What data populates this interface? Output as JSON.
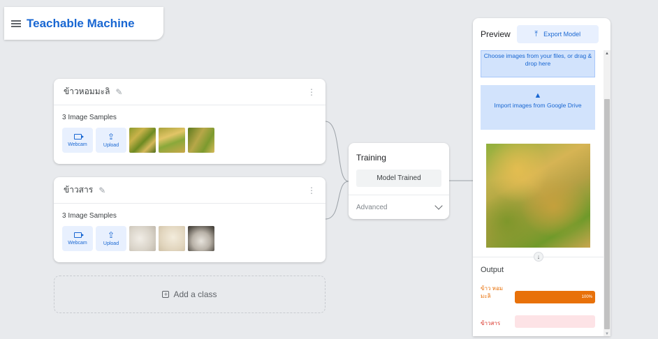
{
  "app": {
    "title": "Teachable Machine"
  },
  "classes": [
    {
      "name": "ข้าวหอมมะลิ",
      "samples_label": "3 Image Samples",
      "webcam_label": "Webcam",
      "upload_label": "Upload"
    },
    {
      "name": "ข้าวสาร",
      "samples_label": "3 Image Samples",
      "webcam_label": "Webcam",
      "upload_label": "Upload"
    }
  ],
  "add_class": {
    "label": "Add a class"
  },
  "training": {
    "title": "Training",
    "button_label": "Model Trained",
    "advanced_label": "Advanced"
  },
  "preview": {
    "title": "Preview",
    "export_label": "Export Model",
    "drop_text": "Choose images from your files, or drag & drop here",
    "drive_text": "Import images from Google Drive",
    "output_title": "Output",
    "outputs": [
      {
        "label": "ข้าว หอม มะลิ",
        "percent_text": "100%",
        "color": "#e8710a",
        "fill": 1.0
      },
      {
        "label": "ข้าวสาร",
        "percent_text": "",
        "color": "#d93025",
        "fill": 0.0
      }
    ]
  },
  "colors": {
    "accent": "#1967d2",
    "output_orange": "#e8710a",
    "output_pink": "#fde3e6"
  }
}
